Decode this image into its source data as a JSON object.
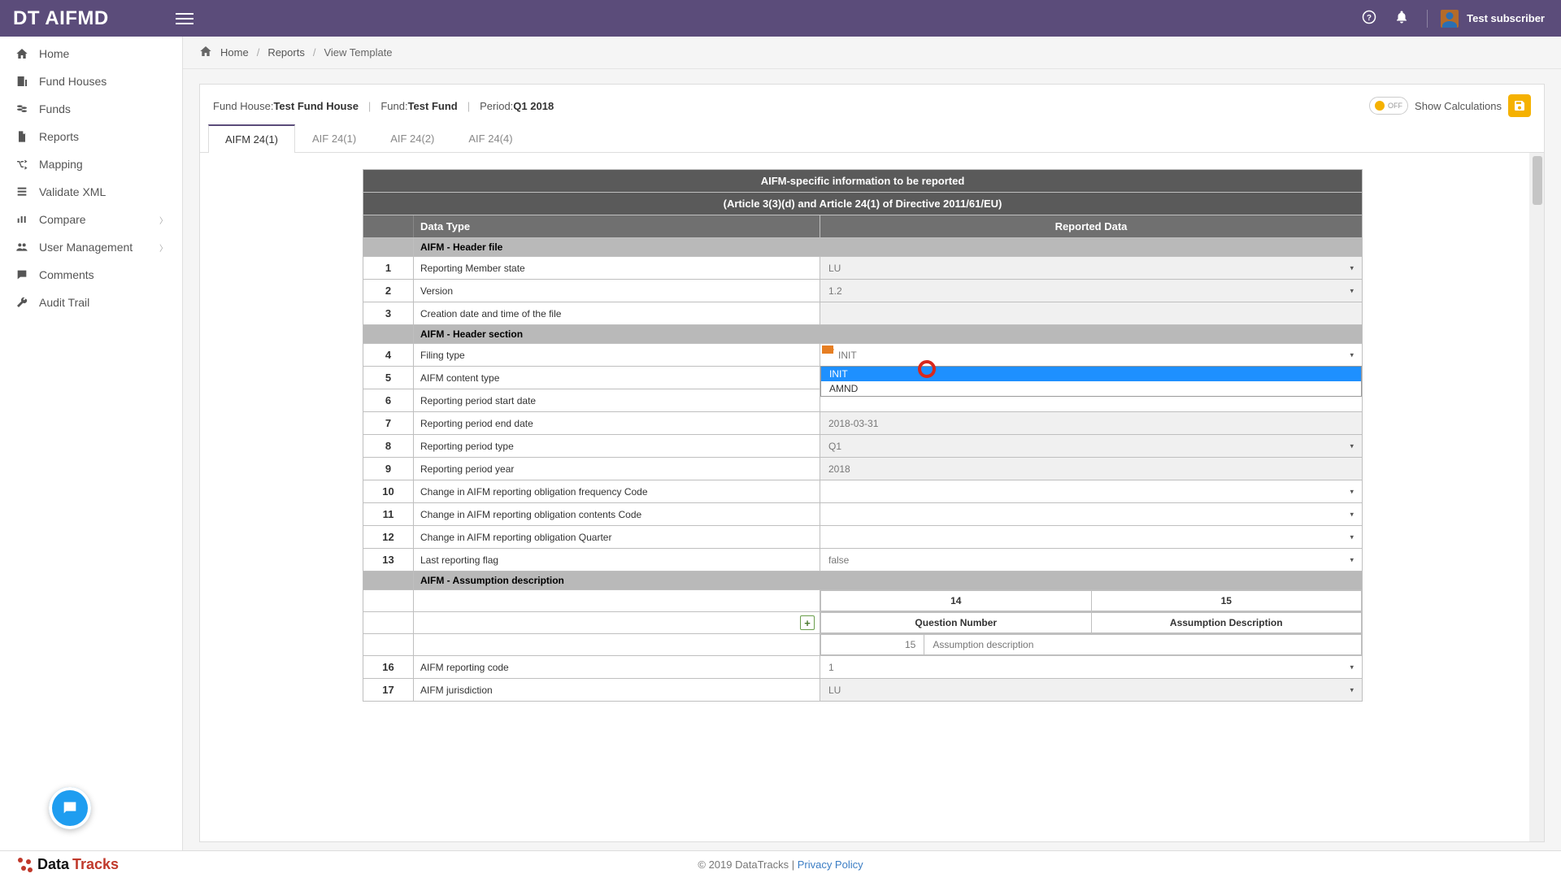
{
  "brand": "DT AIFMD",
  "user_name": "Test subscriber",
  "breadcrumbs": {
    "home": "Home",
    "reports": "Reports",
    "view": "View Template"
  },
  "sidebar": [
    {
      "icon": "home",
      "label": "Home"
    },
    {
      "icon": "building",
      "label": "Fund Houses"
    },
    {
      "icon": "coins",
      "label": "Funds"
    },
    {
      "icon": "file",
      "label": "Reports"
    },
    {
      "icon": "random",
      "label": "Mapping"
    },
    {
      "icon": "stack",
      "label": "Validate XML"
    },
    {
      "icon": "bars",
      "label": "Compare",
      "sub": true
    },
    {
      "icon": "users",
      "label": "User Management",
      "sub": true
    },
    {
      "icon": "comment",
      "label": "Comments"
    },
    {
      "icon": "wrench",
      "label": "Audit Trail"
    }
  ],
  "context": {
    "fund_house_lbl": "Fund House: ",
    "fund_house_val": "Test Fund House",
    "fund_lbl": "Fund: ",
    "fund_val": "Test Fund",
    "period_lbl": "Period: ",
    "period_val": "Q1 2018"
  },
  "toggle_off_text": "OFF",
  "show_calc": "Show Calculations",
  "tabs": [
    "AIFM 24(1)",
    "AIF 24(1)",
    "AIF 24(2)",
    "AIF 24(4)"
  ],
  "active_tab": 0,
  "table": {
    "title1": "AIFM-specific information to be reported",
    "title2": "(Article 3(3)(d) and Article 24(1) of Directive 2011/61/EU)",
    "col_data_type": "Data Type",
    "col_reported": "Reported Data",
    "section_header_file": "AIFM - Header file",
    "section_header_section": "AIFM - Header section",
    "section_assumption": "AIFM - Assumption description",
    "rows_hf": [
      {
        "n": "1",
        "label": "Reporting Member state",
        "value": "LU",
        "ro": true,
        "caret": true
      },
      {
        "n": "2",
        "label": "Version",
        "value": "1.2",
        "ro": true,
        "caret": true
      },
      {
        "n": "3",
        "label": "Creation date and time of the file",
        "value": "",
        "ro": true,
        "caret": false
      }
    ],
    "rows_hs": [
      {
        "n": "4",
        "label": "Filing type",
        "value": "INIT",
        "ro": false,
        "caret": true,
        "flag": true,
        "dropdown": [
          "INIT",
          "AMND"
        ],
        "dd_sel": 0,
        "circle": true
      },
      {
        "n": "5",
        "label": "AIFM content type",
        "value": "",
        "ro": false,
        "caret": false,
        "covered": true
      },
      {
        "n": "6",
        "label": "Reporting period start date",
        "value": "",
        "ro": false,
        "caret": false,
        "covered": true
      },
      {
        "n": "7",
        "label": "Reporting period end date",
        "value": "2018-03-31",
        "ro": true,
        "caret": false
      },
      {
        "n": "8",
        "label": "Reporting period type",
        "value": "Q1",
        "ro": true,
        "caret": true
      },
      {
        "n": "9",
        "label": "Reporting period year",
        "value": "2018",
        "ro": true,
        "caret": false
      },
      {
        "n": "10",
        "label": "Change in AIFM reporting obligation frequency Code",
        "value": "",
        "ro": false,
        "caret": true
      },
      {
        "n": "11",
        "label": "Change in AIFM reporting obligation contents Code",
        "value": "",
        "ro": false,
        "caret": true
      },
      {
        "n": "12",
        "label": "Change in AIFM reporting obligation Quarter",
        "value": "",
        "ro": false,
        "caret": true
      },
      {
        "n": "13",
        "label": "Last reporting flag",
        "value": "false",
        "ro": false,
        "caret": true
      }
    ],
    "sub14": "14",
    "sub15": "15",
    "sub14_lbl": "Question Number",
    "sub15_lbl": "Assumption Description",
    "assump_qn": "15",
    "assump_desc": "Assumption description",
    "rows_tail": [
      {
        "n": "16",
        "label": "AIFM reporting code",
        "value": "1",
        "ro": false,
        "caret": true
      },
      {
        "n": "17",
        "label": "AIFM jurisdiction",
        "value": "LU",
        "ro": true,
        "caret": true
      }
    ]
  },
  "footer": {
    "copyright": "© 2019 DataTracks",
    "sep": " | ",
    "privacy": "Privacy Policy",
    "logo1": "Data",
    "logo2": "Tracks"
  }
}
